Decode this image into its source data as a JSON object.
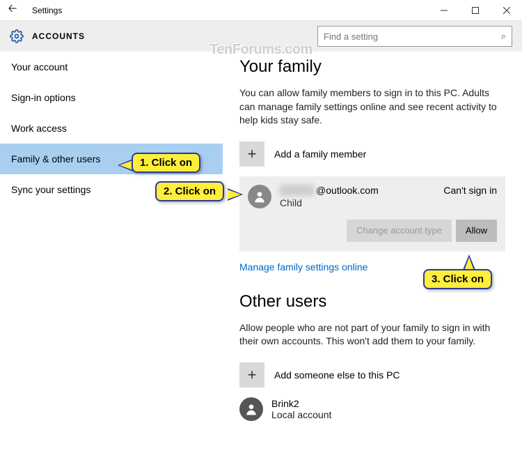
{
  "window": {
    "title": "Settings"
  },
  "header": {
    "title": "ACCOUNTS",
    "search_placeholder": "Find a setting"
  },
  "sidebar": {
    "items": [
      {
        "label": "Your account"
      },
      {
        "label": "Sign-in options"
      },
      {
        "label": "Work access"
      },
      {
        "label": "Family & other users"
      },
      {
        "label": "Sync your settings"
      }
    ],
    "selected_index": 3
  },
  "family": {
    "title": "Your family",
    "description": "You can allow family members to sign in to this PC. Adults can manage family settings online and see recent activity to help kids stay safe.",
    "add_label": "Add a family member",
    "member": {
      "email_hidden": "hidden",
      "email_suffix": "@outlook.com",
      "status": "Can't sign in",
      "role": "Child",
      "change_btn": "Change account type",
      "allow_btn": "Allow"
    },
    "manage_link": "Manage family settings online"
  },
  "other": {
    "title": "Other users",
    "description": "Allow people who are not part of your family to sign in with their own accounts. This won't add them to your family.",
    "add_label": "Add someone else to this PC",
    "user": {
      "name": "Brink2",
      "type": "Local account"
    }
  },
  "callouts": {
    "c1": "1. Click on",
    "c2": "2. Click on",
    "c3": "3. Click on"
  },
  "watermark": "TenForums.com"
}
